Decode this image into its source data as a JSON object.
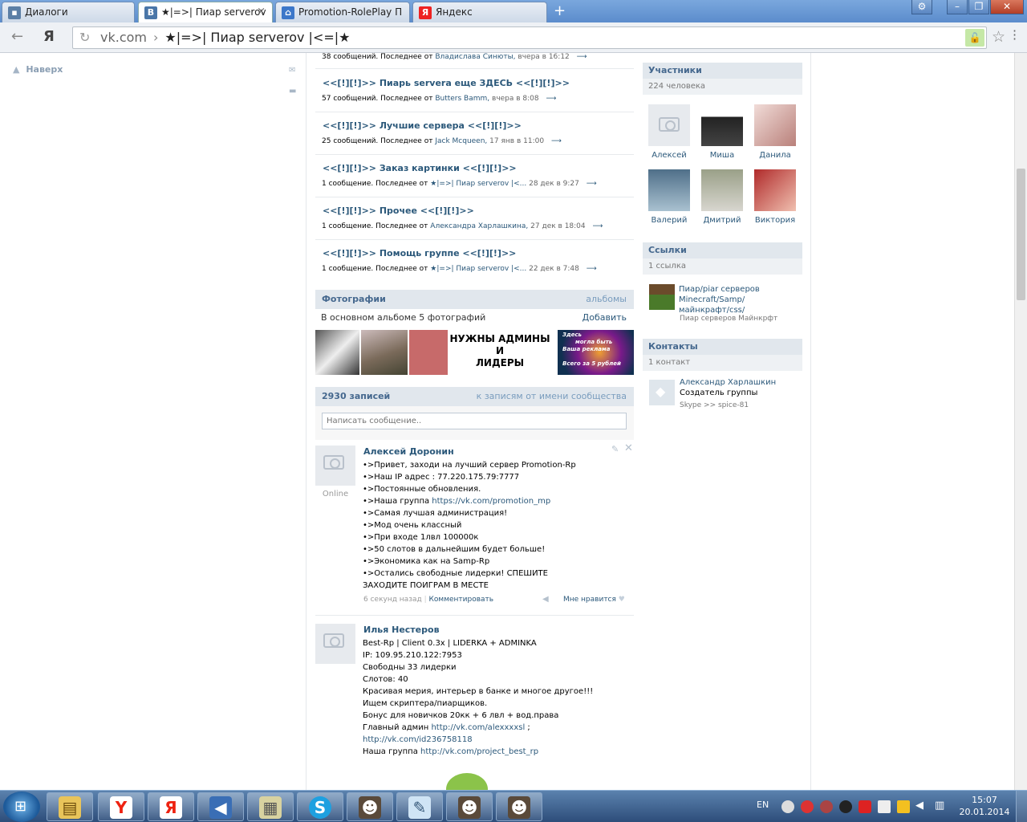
{
  "tabs": [
    {
      "label": "Диалоги",
      "icon": "chat-icon"
    },
    {
      "label": "★|=>| Пиар serverov",
      "icon": "vk-icon"
    },
    {
      "label": "Promotion-RolePlay П",
      "icon": "home-icon"
    },
    {
      "label": "Яндекс",
      "icon": "yandex-icon"
    }
  ],
  "address": {
    "host": "vk.com",
    "page": "★|=>| Пиар serverov |<=|★"
  },
  "left": {
    "up_label": "Наверх"
  },
  "topics": [
    {
      "title": "",
      "meta_count": "38 сообщений. Последнее от",
      "meta_name": "Владислава Синюты,",
      "meta_date": "вчера в 16:12"
    },
    {
      "title": "<<[!][!]>> Пиарь servera еще ЗДЕСЬ <<[!][!]>>",
      "meta_count": "57 сообщений. Последнее от",
      "meta_name": "Butters Bamm,",
      "meta_date": "вчера в 8:08"
    },
    {
      "title": "<<[!][!]>> Лучшие сервера <<[!][!]>>",
      "meta_count": "25 сообщений. Последнее от",
      "meta_name": "Jack Mcqueen,",
      "meta_date": "17 янв в 11:00"
    },
    {
      "title": "<<[!][!]>> Заказ картинки <<[!][!]>>",
      "meta_count": "1 сообщение. Последнее от",
      "meta_name": "★|=>| Пиар serverov |<...",
      "meta_date": "28 дек в 9:27"
    },
    {
      "title": "<<[!][!]>> Прочее <<[!][!]>>",
      "meta_count": "1 сообщение. Последнее от",
      "meta_name": "Александра Харлашкина,",
      "meta_date": "27 дек в 18:04"
    },
    {
      "title": "<<[!][!]>> Помощь группе <<[!][!]>>",
      "meta_count": "1 сообщение. Последнее от",
      "meta_name": "★|=>| Пиар serverov |<...",
      "meta_date": "22 дек в 7:48"
    }
  ],
  "photos": {
    "header": "Фотографии",
    "albums_link": "альбомы",
    "subtitle": "В основном альбоме 5 фотографий",
    "add_label": "Добавить",
    "banner_text_1": "НУЖНЫ АДМИНЫ",
    "banner_text_2": "И",
    "banner_text_3": "ЛИДЕРЫ",
    "promo_text_1": "Здесь",
    "promo_text_2": "могла быть",
    "promo_text_3": "Ваша реклама",
    "promo_text_4": "Всего за 5 рублей"
  },
  "wall": {
    "count_label": "2930 записей",
    "community_link": "к записям от имени сообщества",
    "input_placeholder": "Написать сообщение.."
  },
  "posts": [
    {
      "author": "Алексей Доронин",
      "online": "Online",
      "lines": [
        "•>Привет, заходи на лучший сервер Promotion-Rp",
        "•>Наш IP адрес : 77.220.175.79:7777",
        "•>Постоянные обновления.",
        "•>Наша группа ",
        "•>Самая лучшая администрация!",
        "•>Мод очень классный",
        "•>При входе 1лвл 100000к",
        "•>50 слотов в дальнейшим будет больше!",
        "•>Экономика как на Samp-Rp",
        "•>Остались свободные лидерки! СПЕШИТЕ",
        "ЗАХОДИТЕ ПОИГРАМ В МЕСТЕ"
      ],
      "link": "https://vk.com/promotion_mp",
      "time": "6 секунд назад",
      "comment_label": "Комментировать",
      "like_label": "Мне нравится"
    },
    {
      "author": "Илья Нестеров",
      "lines": [
        "Best-Rp | Client 0.3x | LIDERKA + ADMINKA",
        "IP: 109.95.210.122:7953",
        "Свободны 33 лидерки",
        "Слотов: 40",
        "Красивая мерия, интерьер в банке и многое другое!!!",
        "Ищем скриптера/пиарщиков.",
        "Бонус для новичков 20кк + 6 лвл + вод.права",
        "Главный админ ",
        "",
        "Наша группа "
      ],
      "link_admin": "http://vk.com/alexxxxsl",
      "link_admin_suffix": " ;",
      "link_id": "http://vk.com/id236758118",
      "link_group": "http://vk.com/project_best_rp"
    }
  ],
  "members": {
    "header": "Участники",
    "count": "224 человека",
    "list": [
      {
        "name": "Алексей",
        "color": "#e7eaee"
      },
      {
        "name": "Миша",
        "color": "#4a4a4a"
      },
      {
        "name": "Данила",
        "color": "#d9a5a0"
      },
      {
        "name": "Валерий",
        "color": "#6c8fa8"
      },
      {
        "name": "Дмитрий",
        "color": "#8b8f7c"
      },
      {
        "name": "Виктория",
        "color": "#c84a4a"
      }
    ]
  },
  "links": {
    "header": "Ссылки",
    "count": "1 ссылка",
    "title_1": "Пиар/piar серверов",
    "title_2": "Minecraft/Samp/",
    "title_3": "майнкрафт/css/",
    "desc": "Пиар серверов Майнкрфт"
  },
  "contacts": {
    "header": "Контакты",
    "count": "1 контакт",
    "name": "Александр Харлашкин",
    "role": "Создатель группы",
    "skype": "Skype >> spice-81"
  },
  "taskbar": {
    "lang": "EN",
    "time": "15:07",
    "date": "20.01.2014"
  }
}
